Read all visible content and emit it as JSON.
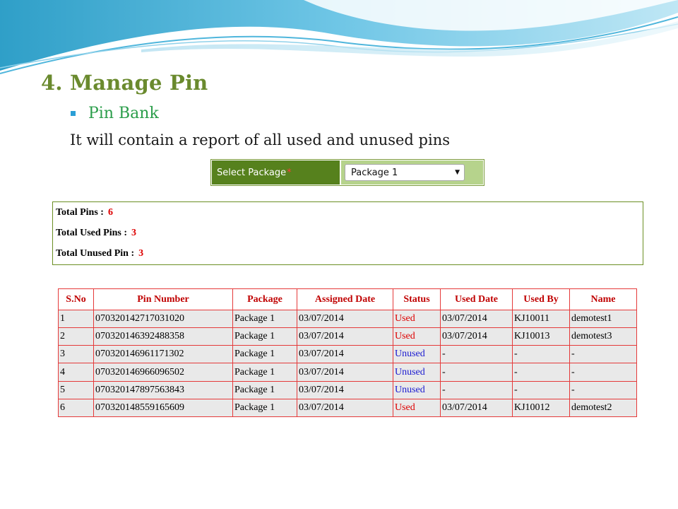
{
  "slide": {
    "title": "4. Manage Pin",
    "bullet": "Pin Bank",
    "description": "It will contain a report of all used and unused pins"
  },
  "package_bar": {
    "label": "Select Package",
    "required_mark": "*",
    "selected": "Package 1",
    "dropdown_icon": "chevron-down-icon"
  },
  "summary": {
    "total_pins_label": "Total Pins :",
    "total_pins_value": "6",
    "total_used_label": "Total Used Pins :",
    "total_used_value": "3",
    "total_unused_label": "Total Unused Pin :",
    "total_unused_value": "3"
  },
  "table": {
    "headers": [
      "S.No",
      "Pin Number",
      "Package",
      "Assigned Date",
      "Status",
      "Used Date",
      "Used By",
      "Name"
    ],
    "rows": [
      [
        "1",
        "070320142717031020",
        "Package 1",
        "03/07/2014",
        "Used",
        "03/07/2014",
        "KJ10011",
        "demotest1"
      ],
      [
        "2",
        "070320146392488358",
        "Package 1",
        "03/07/2014",
        "Used",
        "03/07/2014",
        "KJ10013",
        "demotest3"
      ],
      [
        "3",
        "070320146961171302",
        "Package 1",
        "03/07/2014",
        "Unused",
        "-",
        "-",
        "-"
      ],
      [
        "4",
        "070320146966096502",
        "Package 1",
        "03/07/2014",
        "Unused",
        "-",
        "-",
        "-"
      ],
      [
        "5",
        "070320147897563843",
        "Package 1",
        "03/07/2014",
        "Unused",
        "-",
        "-",
        "-"
      ],
      [
        "6",
        "070320148559165609",
        "Package 1",
        "03/07/2014",
        "Used",
        "03/07/2014",
        "KJ10012",
        "demotest2"
      ]
    ]
  },
  "colors": {
    "title": "#6a8a2e",
    "bullet_text": "#2a9d4a",
    "package_label_bg": "#56811d",
    "package_select_bg": "#b6d38c",
    "table_border": "#e53a3a",
    "header_text": "#c00000",
    "used_status": "#dd0000",
    "unused_status": "#1a1ad0"
  }
}
